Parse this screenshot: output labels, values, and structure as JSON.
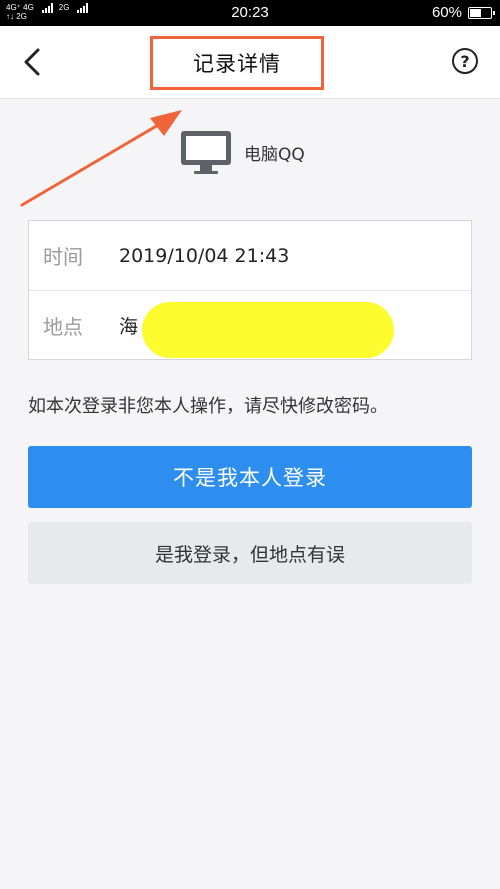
{
  "status_bar": {
    "network_1": "4G⁺ 4G",
    "network_1b": "↑↓ 2G",
    "network_2": "2G",
    "time": "20:23",
    "battery_text": "60%",
    "battery_level": 0.6
  },
  "nav": {
    "title": "记录详情",
    "back_icon": "chevron-left-icon",
    "help_icon": "question-circle-icon",
    "help_glyph": "?"
  },
  "device": {
    "icon": "monitor-icon",
    "label": "电脑QQ"
  },
  "record": {
    "time_label": "时间",
    "time_value": "2019/10/04 21:43",
    "location_label": "地点",
    "location_value": "海"
  },
  "notice": "如本次登录非您本人操作，请尽快修改密码。",
  "buttons": {
    "not_me": "不是我本人登录",
    "is_me_wrong_location": "是我登录，但地点有误"
  },
  "colors": {
    "primary": "#2e8ef0",
    "annotation": "#f0643a",
    "highlight": "#fbfb2e"
  }
}
